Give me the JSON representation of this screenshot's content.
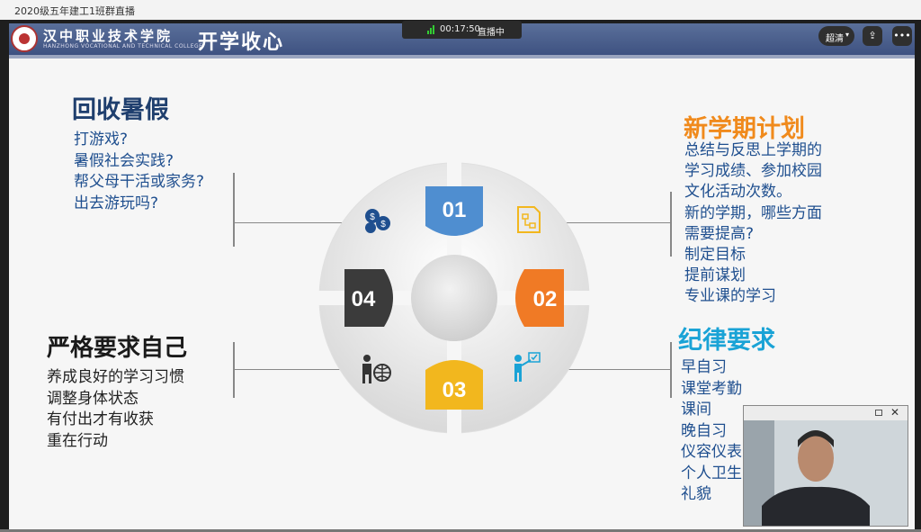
{
  "window": {
    "title": "2020级五年建工1班群直播"
  },
  "live": {
    "duration": "00:17:50",
    "status": "直播中"
  },
  "controls": {
    "quality": "超清"
  },
  "slide": {
    "school_cn": "汉中职业技术学院",
    "school_en": "HANZHONG VOCATIONAL AND TECHNICAL COLLEGE",
    "course": "开学收心",
    "section1": {
      "title": "回收暑假",
      "items": [
        "打游戏?",
        "暑假社会实践?",
        "帮父母干活或家务?",
        "出去游玩吗?"
      ]
    },
    "section2": {
      "title": "新学期计划",
      "items": [
        "总结与反思上学期的",
        "学习成绩、参加校园",
        "文化活动次数。",
        "新的学期，哪些方面",
        "需要提高?",
        "制定目标",
        "提前谋划",
        "专业课的学习"
      ]
    },
    "section3": {
      "title": "纪律要求",
      "items": [
        "早自习",
        "课堂考勤",
        "课间",
        "晚自习",
        "仪容仪表",
        "个人卫生",
        "礼貌"
      ]
    },
    "section4": {
      "title": "严格要求自己",
      "items": [
        "养成良好的学习习惯",
        "调整身体状态",
        "有付出才有收获",
        "重在行动"
      ]
    },
    "numbers": [
      "01",
      "02",
      "03",
      "04"
    ],
    "colors": {
      "n1": "#4f8ed0",
      "n2": "#f07a25",
      "n3": "#f2b71e",
      "n4": "#3b3b3b"
    }
  },
  "icons": {
    "i1": "money-icon",
    "i2": "flowchart-icon",
    "i3": "presenter-icon",
    "i4": "businessman-globe-icon"
  }
}
